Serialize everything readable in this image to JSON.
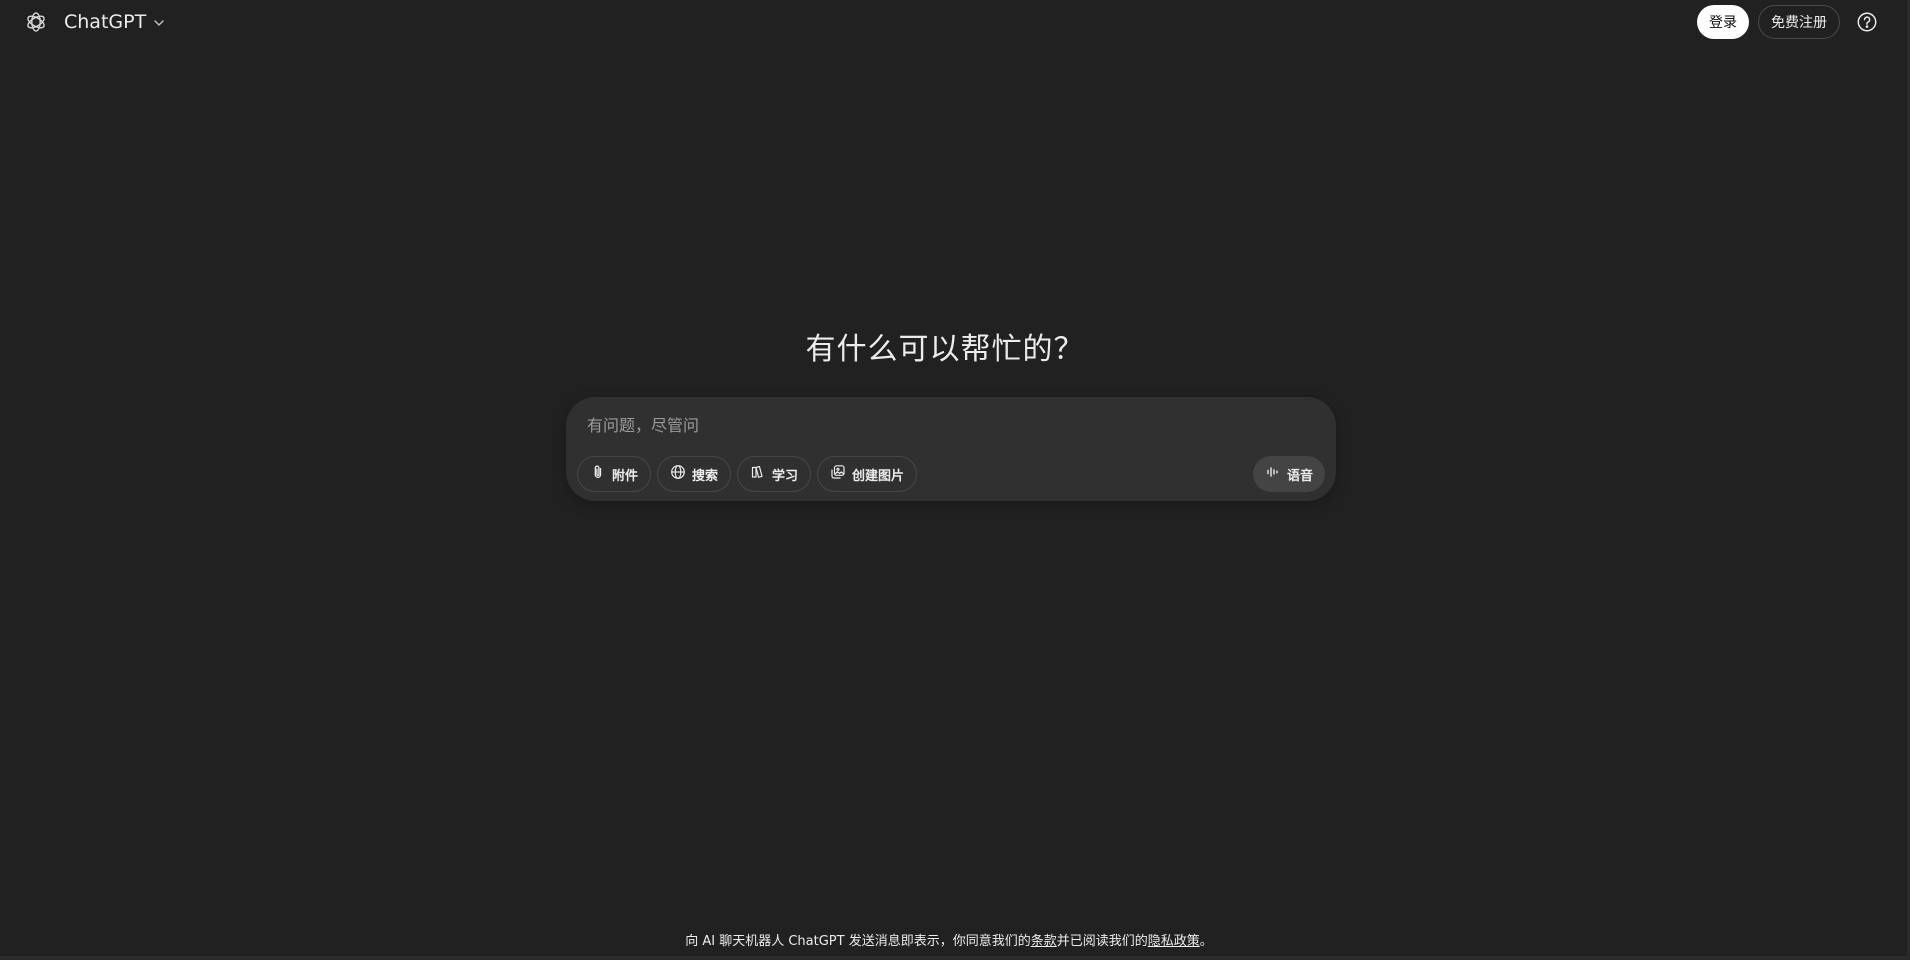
{
  "header": {
    "model_name": "ChatGPT",
    "login_label": "登录",
    "signup_label": "免费注册",
    "help_icon": "help-icon",
    "logo_icon": "openai-logo-icon"
  },
  "main": {
    "headline": "有什么可以帮忙的？"
  },
  "composer": {
    "placeholder": "有问题，尽管问",
    "value": "",
    "tools": [
      {
        "icon": "paperclip-icon",
        "label": "附件"
      },
      {
        "icon": "globe-icon",
        "label": "搜索"
      },
      {
        "icon": "book-icon",
        "label": "学习"
      },
      {
        "icon": "image-icon",
        "label": "创建图片"
      }
    ],
    "voice": {
      "icon": "voice-wave-icon",
      "label": "语音"
    }
  },
  "footer": {
    "prefix": "向 AI 聊天机器人 ChatGPT 发送消息即表示，你同意我们的",
    "terms_link": "条款",
    "middle": "并已阅读我们的",
    "privacy_link": "隐私政策",
    "suffix": "。"
  },
  "colors": {
    "background": "#212121",
    "composer": "#303030",
    "text": "#ececec",
    "placeholder": "#9b9b9b",
    "login_bg": "#ffffff"
  }
}
